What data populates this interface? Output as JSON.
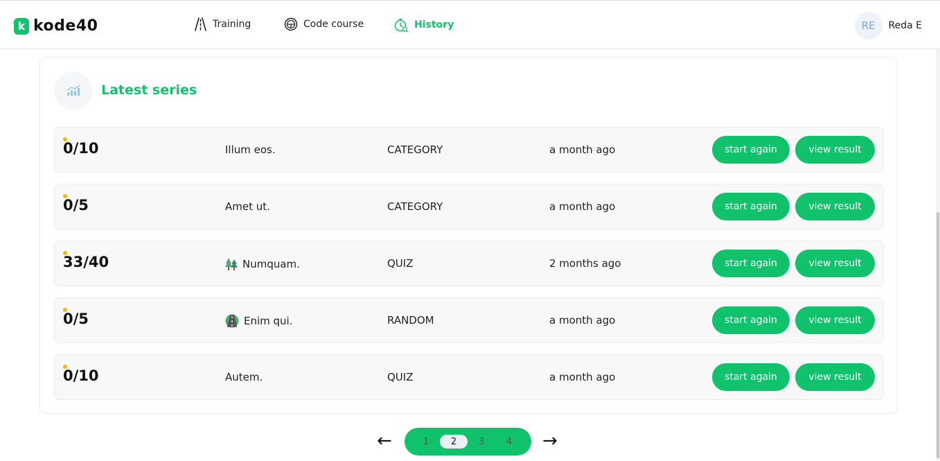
{
  "header": {
    "logo_letter": "k",
    "logo_text": "kode40",
    "nav": [
      {
        "label": "Training",
        "icon": "road-icon"
      },
      {
        "label": "Code course",
        "icon": "steering-wheel-icon"
      },
      {
        "label": "History",
        "icon": "stopwatch-history-icon",
        "active": true
      }
    ],
    "user": {
      "initials": "RE",
      "name": "Reda E"
    }
  },
  "series": {
    "title": "Latest series",
    "icon": "bar-chart-icon",
    "rows": [
      {
        "score": "0/10",
        "name": "Illum eos.",
        "icon": "",
        "category": "CATEGORY",
        "time": "a month ago"
      },
      {
        "score": "0/5",
        "name": "Amet ut.",
        "icon": "",
        "category": "CATEGORY",
        "time": "a month ago"
      },
      {
        "score": "33/40",
        "name": "Numquam.",
        "icon": "forest-icon",
        "category": "QUIZ",
        "time": "2 months ago"
      },
      {
        "score": "0/5",
        "name": "Enim qui.",
        "icon": "road-lane-icon",
        "category": "RANDOM",
        "time": "a month ago"
      },
      {
        "score": "0/10",
        "name": "Autem.",
        "icon": "",
        "category": "QUIZ",
        "time": "a month ago"
      }
    ],
    "start_label": "start again",
    "view_label": "view result"
  },
  "pagination": {
    "prev": "←",
    "next": "→",
    "pages": [
      "1",
      "2",
      "3",
      "4"
    ],
    "current": "2"
  },
  "colors": {
    "accent": "#11c26d",
    "indicator": "#f5b800"
  }
}
